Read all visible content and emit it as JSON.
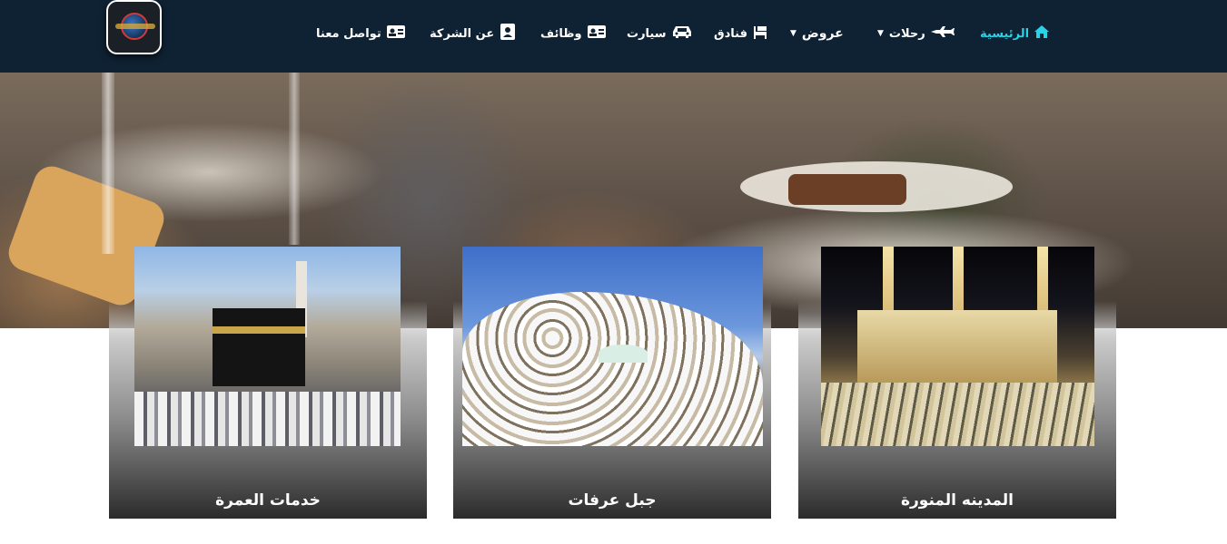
{
  "header": {
    "nav": [
      {
        "label": "الرئيسية",
        "icon": "home-icon",
        "active": true
      },
      {
        "label": "رحلات",
        "icon": "plane-icon",
        "dropdown": true
      },
      {
        "label": "عروض",
        "dropdown": true
      },
      {
        "label": "فنادق",
        "icon": "hotel-icon"
      },
      {
        "label": "سيارت",
        "icon": "car-icon"
      },
      {
        "label": "وظائف",
        "icon": "id-card-icon"
      },
      {
        "label": "عن الشركة",
        "icon": "contact-book-icon"
      },
      {
        "label": "تواصل معنا",
        "icon": "address-card-icon"
      }
    ],
    "colors": {
      "navbar": "#0f2233",
      "active": "#29d3e6",
      "text": "#ffffff"
    }
  },
  "cards": [
    {
      "title": "المدينه المنورة",
      "image": "madinah-mosque-image"
    },
    {
      "title": "جبل عرفات",
      "image": "mount-arafat-image"
    },
    {
      "title": "خدمات العمرة",
      "image": "kaaba-umrah-image"
    }
  ]
}
